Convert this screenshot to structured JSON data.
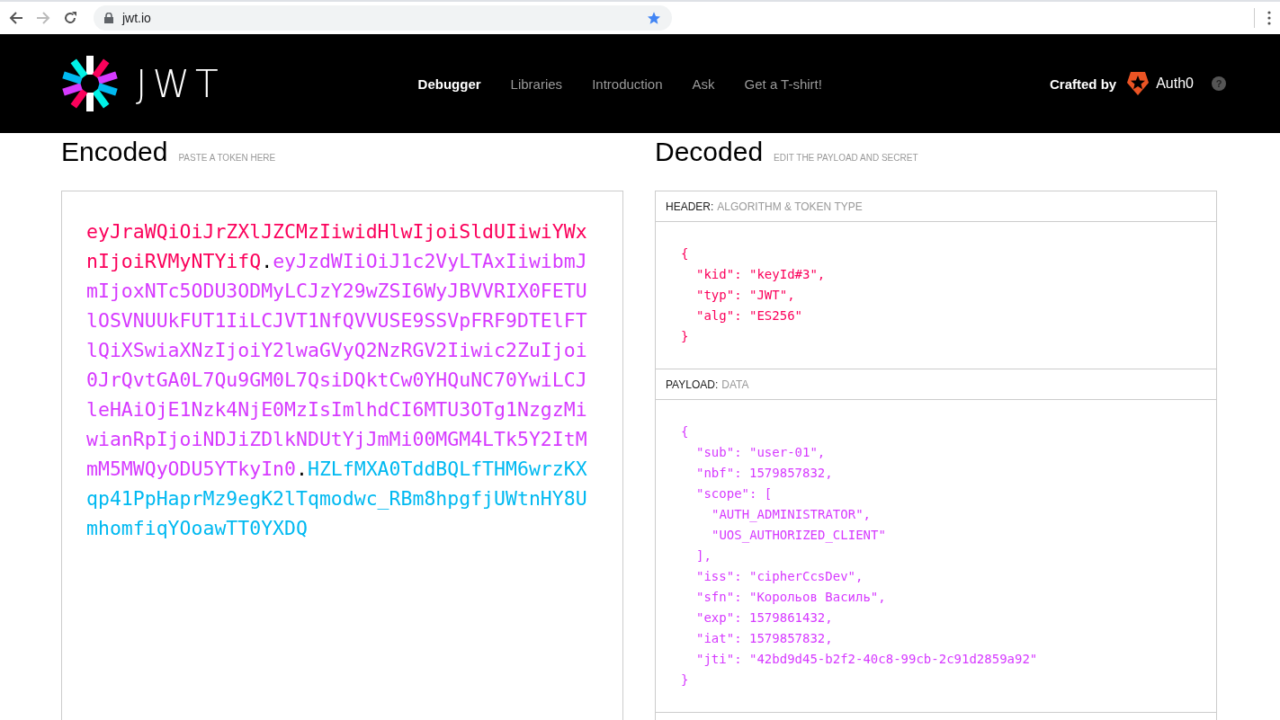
{
  "browser": {
    "url": "jwt.io",
    "back_disabled": false,
    "forward_disabled": true
  },
  "nav": {
    "wordmark": "JWT",
    "items": [
      {
        "label": "Debugger",
        "selected": true
      },
      {
        "label": "Libraries",
        "selected": false
      },
      {
        "label": "Introduction",
        "selected": false
      },
      {
        "label": "Ask",
        "selected": false
      },
      {
        "label": "Get a T-shirt!",
        "selected": false
      }
    ],
    "crafted_by": "Crafted by",
    "brand": "Auth0",
    "help": "?"
  },
  "encoded": {
    "title": "Encoded",
    "subtitle": "PASTE A TOKEN HERE",
    "token": [
      {
        "kind": "header",
        "text": "eyJraWQiOiJrZXlJZCMzIiwidHlwIjoiSldUIiwiYWxnIjoiRVMyNTYifQ"
      },
      {
        "kind": "dot",
        "text": "."
      },
      {
        "kind": "payload",
        "text": "eyJzdWIiOiJ1c2VyLTAxIiwibmJmIjoxNTc5ODU3ODMyLCJzY29wZSI6WyJBVVRIX0FETUlOSVNUUkFUT1IiLCJVT1NfQVVUSE9SSVpFRF9DTElFTlQiXSwiaXNzIjoiY2lwaGVyQ2NzRGV2Iiwic2ZuIjoi0JrQvtGA0L7Qu9GM0L7QsiDQktCw0YHQuNC70YwiLCJleHAiOjE1Nzk4NjE0MzIsImlhdCI6MTU3OTg1NzgzMiwianRpIjoiNDJiZDlkNDUtYjJmMi00MGM4LTk5Y2ItMmM5MWQyODU5YTkyIn0"
      },
      {
        "kind": "dot",
        "text": "."
      },
      {
        "kind": "signature",
        "text": "HZLfMXA0TddBQLfTHM6wrzKXqp41PpHaprMz9egK2lTqmodwc_RBm8hpgfjUWtnHY8UmhomfiqYOoawTT0YXDQ"
      }
    ]
  },
  "decoded": {
    "title": "Decoded",
    "subtitle": "EDIT THE PAYLOAD AND SECRET",
    "sections": [
      {
        "kind": "header",
        "label": "HEADER:",
        "caption": "ALGORITHM & TOKEN TYPE",
        "open": "{",
        "close": "}",
        "entries": [
          {
            "text": "\"kid\": \"keyId#3\","
          },
          {
            "text": "\"typ\": \"JWT\","
          },
          {
            "text": "\"alg\": \"ES256\""
          }
        ]
      },
      {
        "kind": "payload",
        "label": "PAYLOAD:",
        "caption": "DATA",
        "open": "{",
        "close": "}",
        "entries": [
          {
            "text": "\"sub\": \"user-01\","
          },
          {
            "text": "\"nbf\": 1579857832,"
          },
          {
            "text": "\"scope\": [",
            "children": [
              {
                "text": "\"AUTH_ADMINISTRATOR\","
              },
              {
                "text": "\"UOS_AUTHORIZED_CLIENT\""
              }
            ],
            "close": "],"
          },
          {
            "text": "\"iss\": \"cipherCcsDev\","
          },
          {
            "text": "\"sfn\": \"Корольов Василь\","
          },
          {
            "text": "\"exp\": 1579861432,"
          },
          {
            "text": "\"iat\": 1579857832,"
          },
          {
            "text": "\"jti\": \"42bd9d45-b2f2-40c8-99cb-2c91d2859a92\""
          }
        ]
      }
    ]
  }
}
